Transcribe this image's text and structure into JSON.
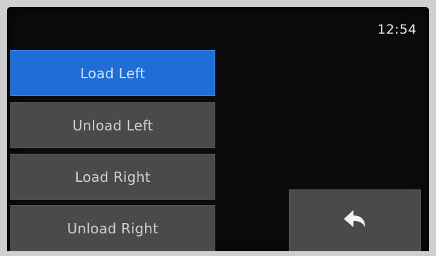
{
  "status": {
    "time": "12:54"
  },
  "menu": {
    "items": [
      {
        "label": "Load Left",
        "active": true
      },
      {
        "label": "Unload Left",
        "active": false
      },
      {
        "label": "Load Right",
        "active": false
      },
      {
        "label": "Unload Right",
        "active": false
      }
    ]
  },
  "back_button": {
    "icon": "back-arrow-icon"
  }
}
